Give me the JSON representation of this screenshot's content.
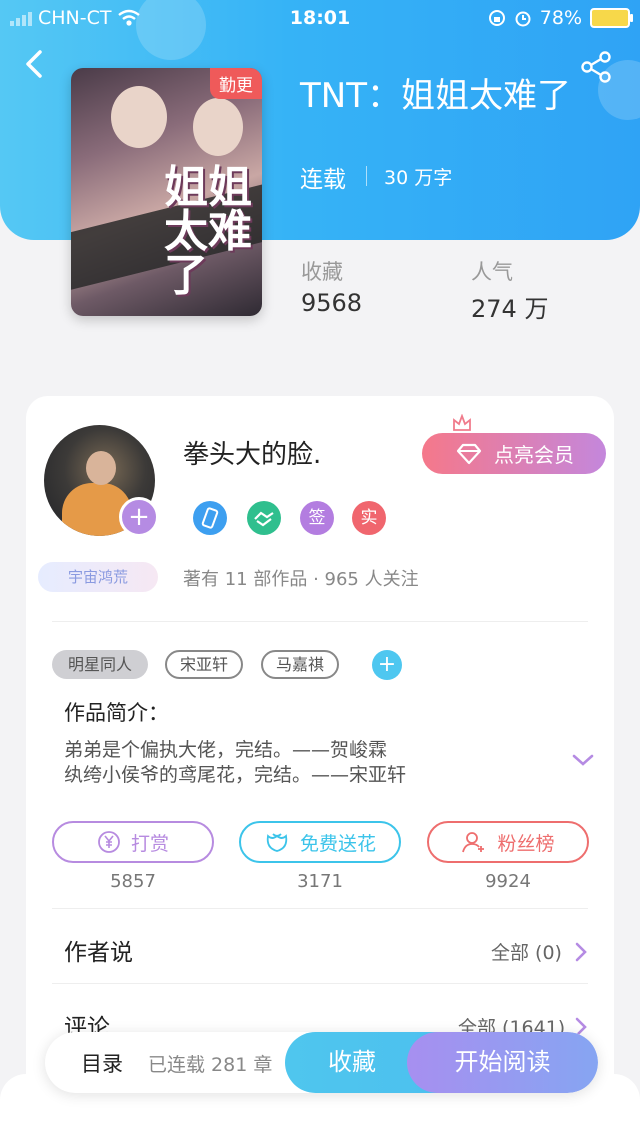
{
  "status_bar": {
    "carrier": "CHN-CT",
    "time": "18:01",
    "battery": "78%"
  },
  "book": {
    "title": "TNT：姐姐太难了",
    "status": "连载",
    "word_count": "30 万字",
    "update_badge": "勤更",
    "cover_title": "姐姐太难了",
    "stats": [
      {
        "label": "收藏",
        "value": "9568"
      },
      {
        "label": "人气",
        "value": "274 万"
      }
    ]
  },
  "author": {
    "name": "拳头大的脸.",
    "badge": "宇宙鸿荒",
    "meta": "著有 11 部作品 · 965 人关注",
    "vip_button": "点亮会员",
    "medals": [
      {
        "icon": "phone-medal-icon",
        "text": "",
        "color": "#3d9ff0"
      },
      {
        "icon": "handshake-medal-icon",
        "text": "",
        "color": "#2fbf8e"
      },
      {
        "icon": "sign-medal-icon",
        "text": "签",
        "color": "#b37de0"
      },
      {
        "icon": "verified-medal-icon",
        "text": "实",
        "color": "#f0666e"
      }
    ]
  },
  "tags": [
    "明星同人",
    "宋亚轩",
    "马嘉祺"
  ],
  "intro": {
    "heading": "作品简介：",
    "lines": [
      "弟弟是个偏执大佬，完结。——贺峻霖",
      "纨绔小侯爷的鸢尾花，完结。——宋亚轩"
    ]
  },
  "actions": [
    {
      "label": "打赏",
      "count": "5857",
      "icon": "yen-icon",
      "color": "#b78be0"
    },
    {
      "label": "免费送花",
      "count": "3171",
      "icon": "flower-icon",
      "color": "#3cc4ea"
    },
    {
      "label": "粉丝榜",
      "count": "9924",
      "icon": "fan-user-icon",
      "color": "#ee6e6e"
    }
  ],
  "author_says": {
    "label": "作者说",
    "link": "全部 (0)"
  },
  "comments": {
    "label": "评论",
    "link": "全部 (1641)"
  },
  "bottom_bar": {
    "toc_label": "目录",
    "toc_count": "已连载 281 章",
    "collect": "收藏",
    "read": "开始阅读"
  }
}
